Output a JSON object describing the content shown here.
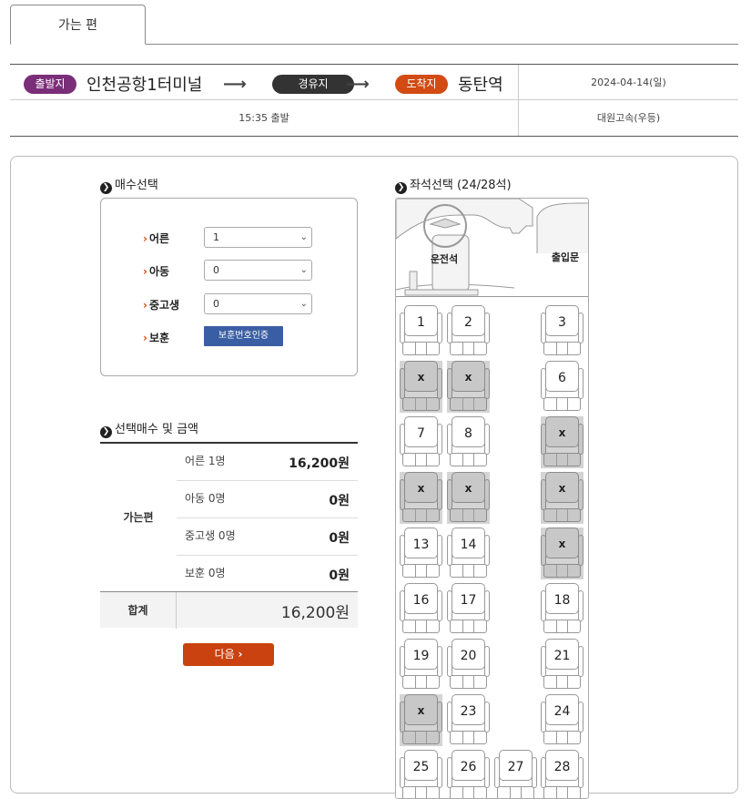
{
  "tabs": {
    "active": "가는 편"
  },
  "route": {
    "departure_badge": "출발지",
    "departure": "인천공항1터미널",
    "via_badge": "경유지",
    "arrival_badge": "도착지",
    "arrival": "동탄역",
    "date": "2024-04-14(일)",
    "departure_time": "15:35 출발",
    "company": "대원고속(우등)",
    "colors": {
      "departure": "#7a2e78",
      "via": "#333333",
      "arrival": "#d34b14"
    }
  },
  "count_section": {
    "title": "매수선택",
    "rows": [
      {
        "label": "어른",
        "value": "1"
      },
      {
        "label": "아동",
        "value": "0"
      },
      {
        "label": "중고생",
        "value": "0"
      },
      {
        "label": "보훈",
        "button": "보훈번호인증"
      }
    ]
  },
  "price_section": {
    "title": "선택매수 및 금액",
    "group_label": "가는편",
    "rows": [
      {
        "name": "어른 1명",
        "amount": "16,200원"
      },
      {
        "name": "아동 0명",
        "amount": "0원"
      },
      {
        "name": "중고생 0명",
        "amount": "0원"
      },
      {
        "name": "보훈 0명",
        "amount": "0원"
      }
    ],
    "total_label": "합계",
    "total_amount": "16,200원"
  },
  "next_button": "다음",
  "seat_section": {
    "title": "좌석선택 (24/28석)",
    "driver_label": "운전석",
    "door_label": "출입문",
    "seats": [
      {
        "num": "1",
        "taken": false
      },
      {
        "num": "2",
        "taken": false
      },
      {
        "num": "3",
        "taken": false
      },
      {
        "num": "x",
        "taken": true
      },
      {
        "num": "x",
        "taken": true
      },
      {
        "num": "6",
        "taken": false
      },
      {
        "num": "7",
        "taken": false
      },
      {
        "num": "8",
        "taken": false
      },
      {
        "num": "x",
        "taken": true
      },
      {
        "num": "x",
        "taken": true
      },
      {
        "num": "x",
        "taken": true
      },
      {
        "num": "x",
        "taken": true
      },
      {
        "num": "13",
        "taken": false
      },
      {
        "num": "14",
        "taken": false
      },
      {
        "num": "x",
        "taken": true
      },
      {
        "num": "16",
        "taken": false
      },
      {
        "num": "17",
        "taken": false
      },
      {
        "num": "18",
        "taken": false
      },
      {
        "num": "19",
        "taken": false
      },
      {
        "num": "20",
        "taken": false
      },
      {
        "num": "21",
        "taken": false
      },
      {
        "num": "x",
        "taken": true
      },
      {
        "num": "23",
        "taken": false
      },
      {
        "num": "24",
        "taken": false
      },
      {
        "num": "25",
        "taken": false
      },
      {
        "num": "26",
        "taken": false
      },
      {
        "num": "27",
        "taken": false
      },
      {
        "num": "28",
        "taken": false
      }
    ]
  }
}
